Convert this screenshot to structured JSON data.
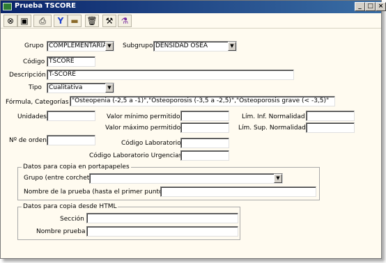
{
  "window": {
    "title": "Prueba TSCORE",
    "minimize": "_",
    "maximize": "□",
    "close": "×"
  },
  "toolbar": {
    "buttons": [
      {
        "name": "close-icon",
        "glyph": "⊗"
      },
      {
        "name": "save-icon",
        "glyph": "▣"
      },
      {
        "name": "print-icon",
        "glyph": "⎙"
      },
      {
        "name": "filter-icon",
        "glyph": "Y"
      },
      {
        "name": "folder-icon",
        "glyph": "▬"
      },
      {
        "name": "trash-icon",
        "glyph": "🗑"
      },
      {
        "name": "tools-icon",
        "glyph": "⚒"
      },
      {
        "name": "test-tube-icon",
        "glyph": "⚗"
      }
    ]
  },
  "form": {
    "grupo_label": "Grupo",
    "grupo_value": "COMPLEMENTARIA",
    "subgrupo_label": "Subgrupo",
    "subgrupo_value": "DENSIDAD OSEA",
    "codigo_label": "Código",
    "codigo_value": "TSCORE",
    "descripcion_label": "Descripción",
    "descripcion_value": "T-SCORE",
    "tipo_label": "Tipo",
    "tipo_value": "Cualitativa",
    "formula_label": "Fórmula, Categorías",
    "formula_value": "\"Osteopenia (-2,5 a -1)\",\"Osteoporosis (-3,5 a -2,5)\",\"Osteoporosis grave (< -3,5)\"",
    "unidades_label": "Unidades",
    "unidades_value": "",
    "valor_min_label": "Valor mínimo permitido",
    "valor_min_value": "",
    "valor_max_label": "Valor máximo permitido",
    "valor_max_value": "",
    "lim_inf_label": "Lím. Inf. Normalidad",
    "lim_inf_value": "",
    "lim_sup_label": "Lím. Sup. Normalidad",
    "lim_sup_value": "",
    "orden_label": "Nº de orden",
    "orden_value": "",
    "cod_lab_label": "Código Laboratorio",
    "cod_lab_value": "",
    "cod_lab_urg_label": "Código Laboratorio Urgencias",
    "cod_lab_urg_value": ""
  },
  "portapapeles": {
    "title": "Datos para copia en portapapeles",
    "grupo_label": "Grupo (entre corchetes)",
    "grupo_value": "",
    "nombre_label": "Nombre de la prueba (hasta el primer punto)",
    "nombre_value": ""
  },
  "html": {
    "title": "Datos para copia desde HTML",
    "seccion_label": "Sección",
    "seccion_value": "",
    "nombre_label": "Nombre prueba",
    "nombre_value": ""
  }
}
